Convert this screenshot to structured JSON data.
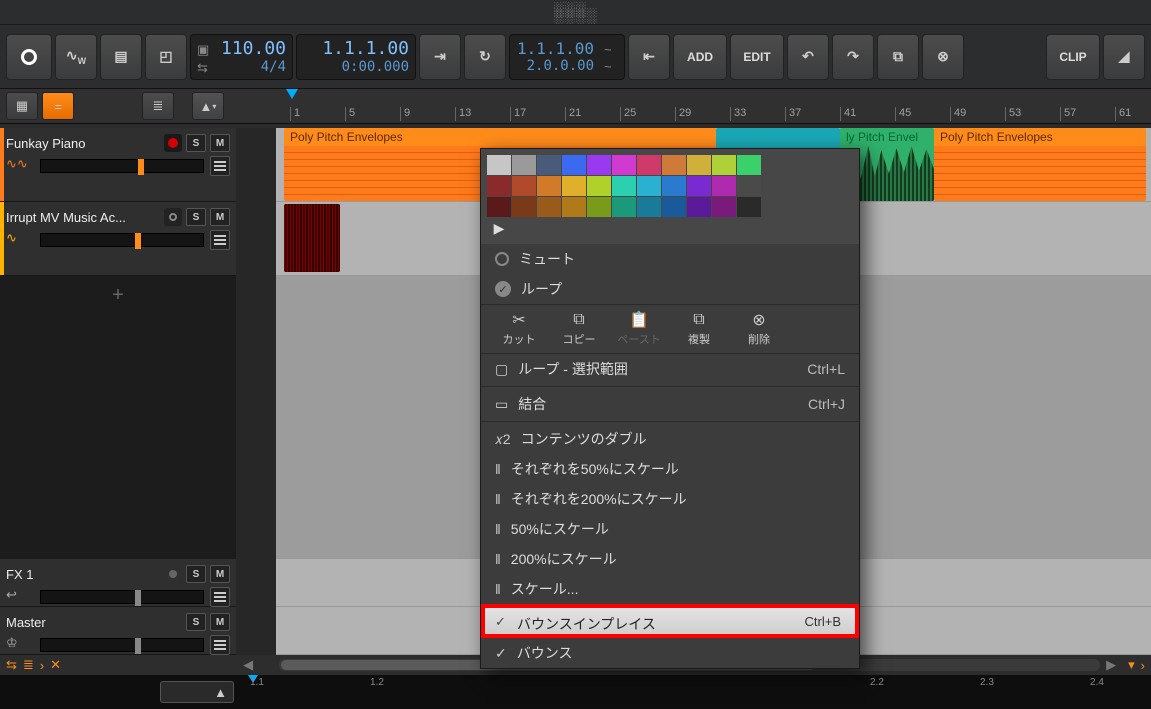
{
  "top": {
    "tempo": "110.00",
    "sig": "4/4",
    "pos_bars": "1.1.1.00",
    "pos_time": "0:00.000",
    "loop_start": "1.1.1.00",
    "loop_len": "2.0.0.00",
    "add": "ADD",
    "edit": "EDIT",
    "clip": "CLIP"
  },
  "ruler": {
    "ticks": [
      "1",
      "5",
      "9",
      "13",
      "17",
      "21",
      "25",
      "29",
      "33",
      "37",
      "41",
      "45",
      "49",
      "53",
      "57",
      "61"
    ]
  },
  "tracks": {
    "t1": {
      "name": "Funkay Piano",
      "color": "#ff7a1a"
    },
    "t2": {
      "name": "Irrupt MV Music Ac...",
      "color": "#ffb300"
    },
    "fx": {
      "name": "FX 1"
    },
    "master": {
      "name": "Master"
    }
  },
  "clips": {
    "c1": "Poly Pitch Envelopes",
    "c2": "ly Pitch Envel",
    "c3": "Poly Pitch Envelopes"
  },
  "ctx": {
    "mute": "ミュート",
    "loop": "ループ",
    "cut": "カット",
    "copy": "コピー",
    "paste": "ペースト",
    "dup": "複製",
    "del": "削除",
    "loop_sel": "ループ - 選択範囲",
    "loop_sel_sc": "Ctrl+L",
    "join": "結合",
    "join_sc": "Ctrl+J",
    "dbl": "コンテンツのダブル",
    "scale50each": "それぞれを50%にスケール",
    "scale200each": "それぞれを200%にスケール",
    "scale50": "50%にスケール",
    "scale200": "200%にスケール",
    "scaleother": "スケール...",
    "bip": "バウンスインプレイス",
    "bip_sc": "Ctrl+B",
    "bounce": "バウンス"
  },
  "palette_colors": [
    "#c6c6c6",
    "#9a9a9a",
    "#4a5a7a",
    "#3a6af0",
    "#9a3af0",
    "#d03ad0",
    "#d03a6a",
    "#d07a3a",
    "#d0b03a",
    "#b0d03a",
    "#3ad06a",
    "#8a2a2a",
    "#b04a2a",
    "#d07a2a",
    "#e0b02a",
    "#b0d02a",
    "#2ad0b0",
    "#2ab0d0",
    "#2a7ad0",
    "#7a2ad0",
    "#b02ab0",
    "#4a4a4a",
    "#5a1a1a",
    "#7a3a1a",
    "#9a5a1a",
    "#b07a1a",
    "#7a9a1a",
    "#1a9a7a",
    "#1a7a9a",
    "#1a5a9a",
    "#5a1a9a",
    "#7a1a7a",
    "#2a2a2a"
  ],
  "minimap": {
    "ticks": [
      "1.1",
      "1.2",
      "2.2",
      "2.3",
      "2.4"
    ]
  }
}
